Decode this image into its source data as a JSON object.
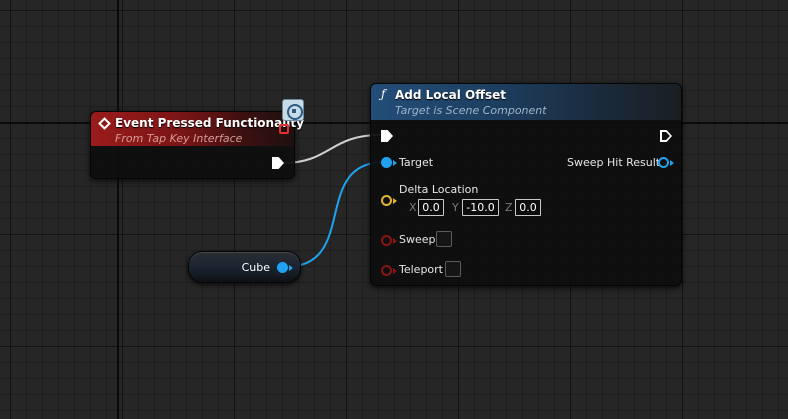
{
  "event_node": {
    "title": "Event Pressed Functionality",
    "subtitle": "From Tap Key Interface"
  },
  "function_node": {
    "title": "Add Local Offset",
    "subtitle": "Target is Scene Component",
    "pins": {
      "target": "Target",
      "delta_location": "Delta Location",
      "sweep": "Sweep",
      "teleport": "Teleport",
      "sweep_hit_result": "Sweep Hit Result"
    },
    "delta_location": {
      "x_label": "X",
      "x_value": "0.0",
      "y_label": "Y",
      "y_value": "-10.0",
      "z_label": "Z",
      "z_value": "0.0"
    },
    "sweep_checked": false,
    "teleport_checked": false
  },
  "variable_node": {
    "label": "Cube"
  },
  "icons": {
    "event": "event-diamond-icon",
    "function": "function-f-icon",
    "interface": "interface-badge-icon"
  },
  "colors": {
    "exec_wire": "#d0d0d0",
    "object_wire": "#1fa3ef",
    "vector_pin": "#e2b62b",
    "bool_pin": "#8a1515",
    "event_header": "#9b1b1b",
    "function_header": "#234d78"
  }
}
